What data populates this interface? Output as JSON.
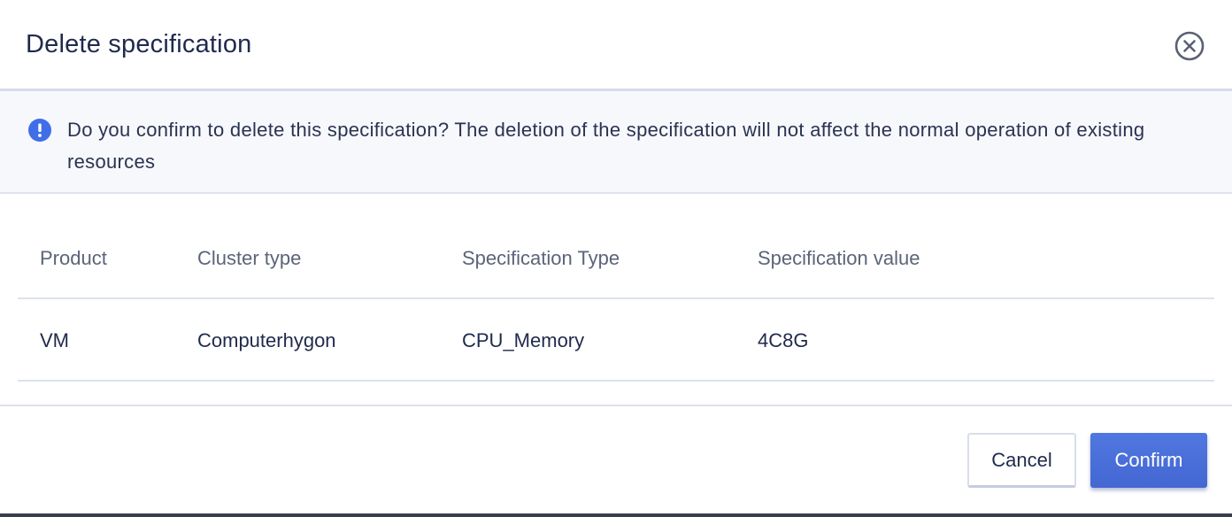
{
  "dialog": {
    "title": "Delete specification",
    "close_icon": "close-circle-icon"
  },
  "notice": {
    "icon": "info-icon",
    "icon_color": "#3f6ee8",
    "text": "Do you confirm to delete this specification? The deletion of the specification will not affect the normal operation of existing resources"
  },
  "table": {
    "columns": [
      "Product",
      "Cluster type",
      "Specification Type",
      "Specification value"
    ],
    "rows": [
      [
        "VM",
        "Computerhygon",
        "CPU_Memory",
        "4C8G"
      ]
    ]
  },
  "footer": {
    "cancel_label": "Cancel",
    "confirm_label": "Confirm",
    "confirm_color": "#4a6fd9"
  }
}
